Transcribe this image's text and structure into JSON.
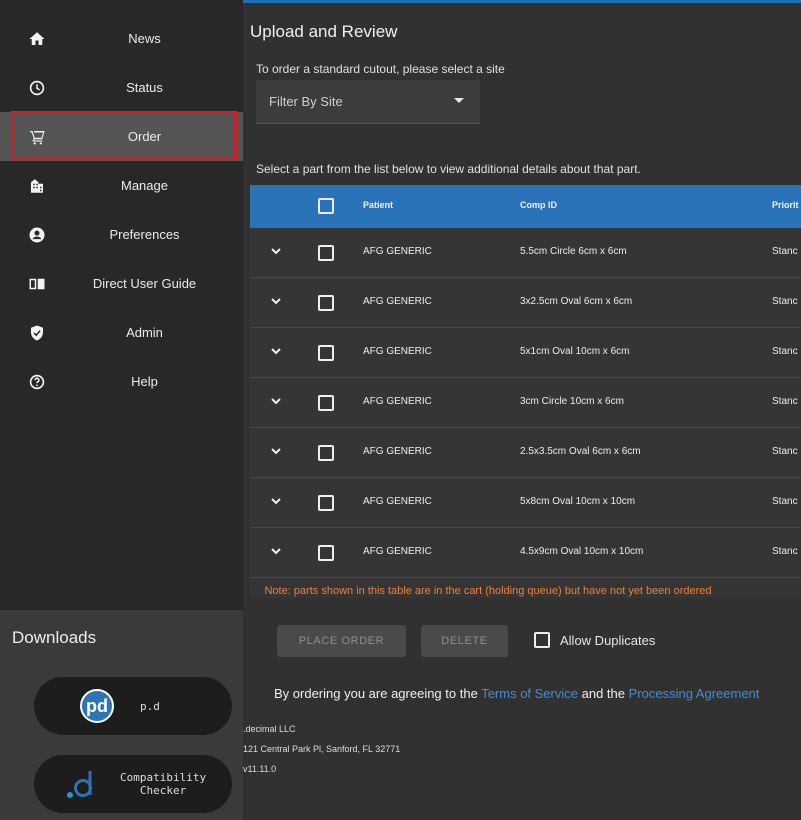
{
  "nav": [
    {
      "label": "News",
      "icon": "home-icon"
    },
    {
      "label": "Status",
      "icon": "clock-icon"
    },
    {
      "label": "Order",
      "icon": "cart-icon",
      "active": true
    },
    {
      "label": "Manage",
      "icon": "manage-icon"
    },
    {
      "label": "Preferences",
      "icon": "account-icon"
    },
    {
      "label": "Direct User Guide",
      "icon": "book-icon"
    },
    {
      "label": "Admin",
      "icon": "shield-icon"
    },
    {
      "label": "Help",
      "icon": "help-icon"
    }
  ],
  "downloads": {
    "title": "Downloads",
    "items": [
      {
        "logo": "pd",
        "label": "p.d"
      },
      {
        "logo": ".d",
        "label": "Compatibility\nChecker"
      }
    ]
  },
  "main": {
    "title": "Upload and Review",
    "site_hint": "To order a standard cutout, please select a site",
    "site_select": "Filter By Site",
    "list_hint": "Select a part from the list below to view additional details about that part.",
    "columns": [
      "Patient",
      "Comp ID",
      "Priorit"
    ],
    "rows": [
      {
        "patient": "AFG GENERIC",
        "comp": "5.5cm Circle 6cm x 6cm",
        "priority": "Stanc"
      },
      {
        "patient": "AFG GENERIC",
        "comp": "3x2.5cm Oval 6cm x 6cm",
        "priority": "Stanc"
      },
      {
        "patient": "AFG GENERIC",
        "comp": "5x1cm Oval 10cm x 6cm",
        "priority": "Stanc"
      },
      {
        "patient": "AFG GENERIC",
        "comp": "3cm Circle 10cm x 6cm",
        "priority": "Stanc"
      },
      {
        "patient": "AFG GENERIC",
        "comp": "2.5x3.5cm Oval 6cm x 6cm",
        "priority": "Stanc"
      },
      {
        "patient": "AFG GENERIC",
        "comp": "5x8cm Oval 10cm x 10cm",
        "priority": "Stanc"
      },
      {
        "patient": "AFG GENERIC",
        "comp": "4.5x9cm Oval 10cm x 10cm",
        "priority": "Stanc"
      }
    ],
    "note": "Note: parts shown in this table are in the cart (holding queue) but have not yet been ordered",
    "place_order": "PLACE ORDER",
    "delete": "DELETE",
    "allow_duplicates": "Allow Duplicates",
    "agree_prefix": "By ordering you are agreeing to the ",
    "terms": "Terms of Service",
    "and_the": " and the ",
    "processing": "Processing Agreement",
    "company": ".decimal LLC",
    "address": "121 Central Park Pl, Sanford, FL 32771",
    "version": "v11.11.0"
  },
  "colors": {
    "accent": "#2a73b9",
    "active_border": "#d11f2a",
    "note": "#e9813b",
    "link": "#3d8ee0"
  }
}
